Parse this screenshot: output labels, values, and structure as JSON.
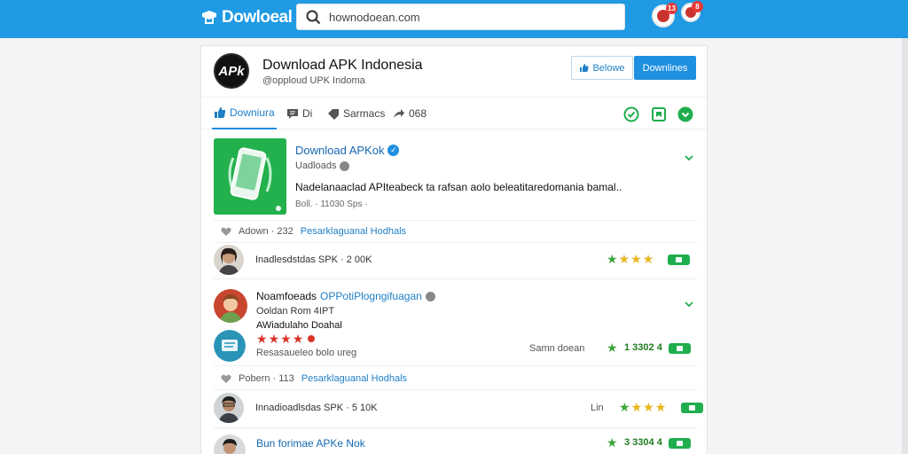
{
  "header": {
    "brand": "Dowloeal",
    "search_placeholder": "hownodoean.com",
    "badges": [
      "13",
      "8"
    ]
  },
  "page": {
    "logo_text": "APk",
    "title": "Download APK Indonesia",
    "handle": "@opploud UPK Indoma",
    "follow_label": "Belowe",
    "download_label": "Downlines"
  },
  "tabs": [
    {
      "label": "Downiura"
    },
    {
      "label": "Di"
    },
    {
      "label": "Sarmacs"
    },
    {
      "label": "068"
    }
  ],
  "post": {
    "title": "Download APKok",
    "subtitle": "Uadloads",
    "description": "Nadelanaaclad APIteabeck ta rafsan aolo beleatitaredomania bamal..",
    "meta": "Boll. · 11030 Sps ·"
  },
  "sections": [
    {
      "stats_text": "Adown · 232",
      "stats_link": "Pesarklaguanal Hodhals",
      "review": {
        "text": "Inadlesdstdas SPK · 2 00K",
        "count": "",
        "side": ""
      }
    },
    {
      "comment": {
        "name": "Noamfoeads",
        "name_link": "OPPotiPlogngifuagan",
        "line1": "Ooldan Rom 4IPT",
        "line2": "AWiadulaho Doahal",
        "line3": "Resasaueleo bolo ureg",
        "side": "Samn doean",
        "count": "1 3302 4"
      }
    },
    {
      "stats_text": "Pobern · 113",
      "stats_link": "Pesarklaguanal Hodhals",
      "review": {
        "text": "Innadioadlsdas SPK · 5 10K",
        "count": "",
        "side": "Lin"
      }
    },
    {
      "footer_post": {
        "title": "Bun forimae APKe Nok",
        "count": "3 3304 4"
      }
    }
  ],
  "colors": {
    "brand_blue": "#1f9ae3",
    "accent_green": "#1fae4e",
    "link_blue": "#1f7fc6"
  }
}
